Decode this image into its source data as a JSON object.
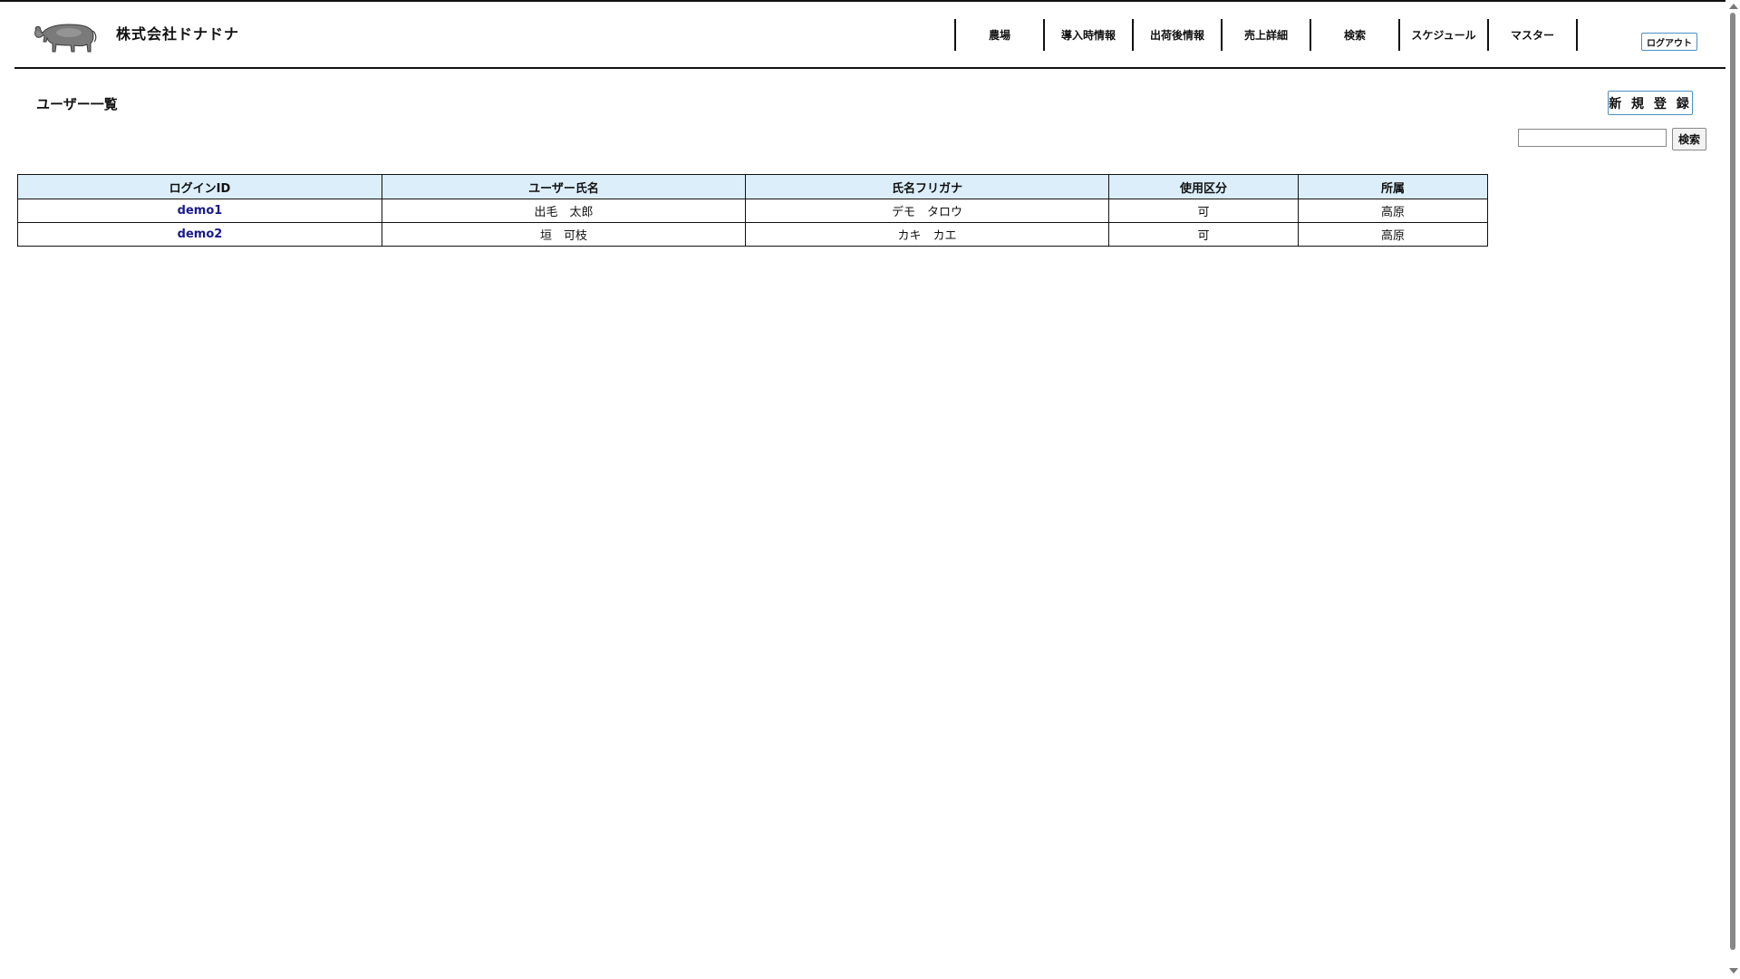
{
  "header": {
    "company_name": "株式会社ドナドナ",
    "nav": [
      "農場",
      "導入時情報",
      "出荷後情報",
      "売上詳細",
      "検索",
      "スケジュール",
      "マスター"
    ],
    "logout_label": "ログアウト"
  },
  "main": {
    "title": "ユーザー一覧",
    "new_button_label": "新 規 登 録",
    "search": {
      "value": "",
      "button_label": "検索"
    },
    "table": {
      "columns": [
        "ログインID",
        "ユーザー氏名",
        "氏名フリガナ",
        "使用区分",
        "所属"
      ],
      "rows": [
        [
          "demo1",
          "出毛　太郎",
          "デモ　タロウ",
          "可",
          "高原"
        ],
        [
          "demo2",
          "垣　可枝",
          "カキ　カエ",
          "可",
          "高原"
        ]
      ]
    }
  }
}
